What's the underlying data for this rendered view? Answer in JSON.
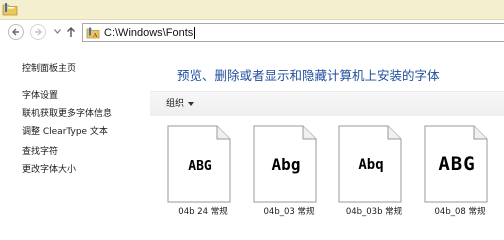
{
  "titlebar": {
    "icon": "folder-icon"
  },
  "navigation": {
    "back_icon": "back-arrow-icon",
    "forward_icon": "forward-arrow-icon",
    "recent_icon": "chevron-down-icon",
    "up_icon": "up-arrow-icon"
  },
  "address_bar": {
    "icon": "folder-icon",
    "path": "C:\\Windows\\Fonts"
  },
  "sidebar": {
    "items": [
      {
        "label": "控制面板主页"
      },
      {
        "label": "字体设置"
      },
      {
        "label": "联机获取更多字体信息"
      },
      {
        "label": "调整 ClearType 文本"
      },
      {
        "label": "查找字符"
      },
      {
        "label": "更改字体大小"
      }
    ]
  },
  "main": {
    "heading": "预览、删除或者显示和隐藏计算机上安装的字体",
    "toolbar": {
      "organize_label": "组织"
    },
    "fonts": [
      {
        "preview": "ABG",
        "name": "04b 24 常规"
      },
      {
        "preview": "Abg",
        "name": "04b_03 常规"
      },
      {
        "preview": "Abq",
        "name": "04b_03b 常规"
      },
      {
        "preview": "ABG",
        "name": "04b_08 常规"
      }
    ]
  }
}
